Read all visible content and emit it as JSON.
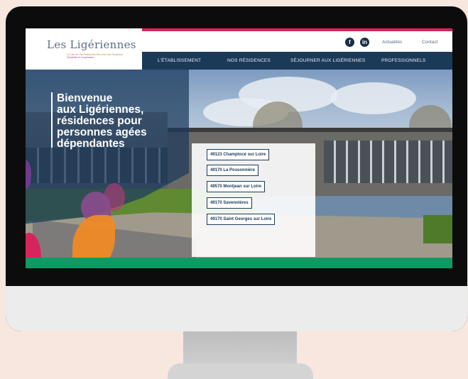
{
  "header": {
    "logo": {
      "name": "Les Ligériennes",
      "line1": "Le Lieu de Vie Résidentiel Bien-être des Résidents",
      "line2": "Solidarité et Coopération",
      "line3": ""
    },
    "social": [
      {
        "icon": "facebook-icon",
        "glyph": "f"
      },
      {
        "icon": "linkedin-icon",
        "glyph": "in"
      }
    ],
    "top_links": [
      "Actualités",
      "Contact"
    ],
    "nav": [
      "L'ÉTABLISSEMENT",
      "NOS RÉSIDENCES",
      "SÉJOURNER AUX LIGÉRIENNES",
      "PROFESSIONNELS"
    ]
  },
  "hero": {
    "welcome": "Bienvenue\naux Ligériennes,\nrésidences pour\npersonnes agées\ndépendantes",
    "locations": [
      "49123 Champtocé sur Loire",
      "49170 La Possonnière",
      "49570 Montjean sur Loire",
      "49170 Savennières",
      "49170 Saint Georges sur Loire"
    ]
  },
  "colors": {
    "accent_pink": "#d8245c",
    "nav_blue": "#1b3a58",
    "band_green": "#0f9a63",
    "orange": "#ef8a26",
    "purple": "#8c4b8e"
  }
}
